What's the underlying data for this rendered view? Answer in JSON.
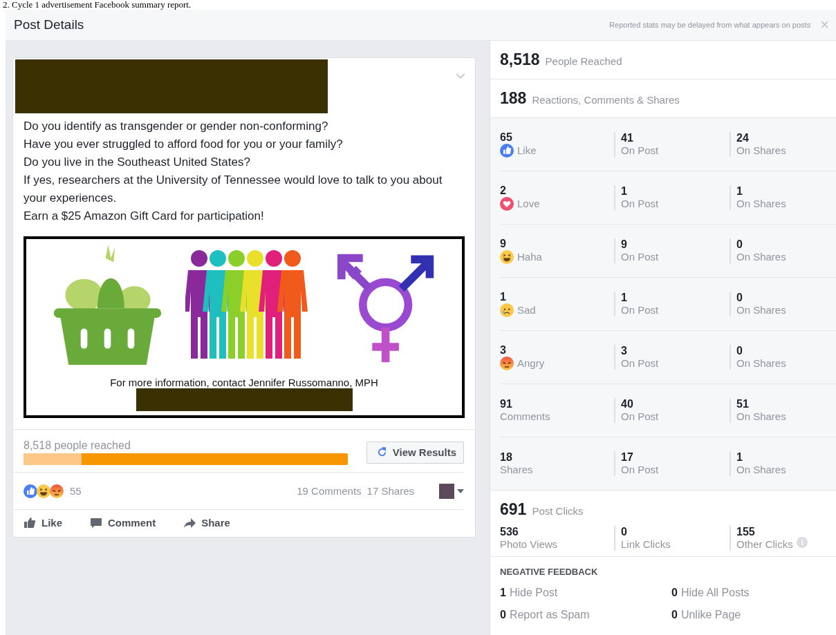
{
  "document_caption": "2. Cycle 1 advertisement Facebook summary report.",
  "header": {
    "title": "Post Details",
    "note": "Reported stats may be delayed from what appears on posts",
    "close": "×"
  },
  "post": {
    "text_lines": [
      "Do you identify as transgender or gender non-conforming?",
      "Have you ever struggled to afford food for you or your family?",
      "Do you live in the Southeast United States?",
      "If yes, researchers at the University of Tennessee would love to talk to you about your experiences.",
      "Earn a $25 Amazon Gift Card for participation!"
    ],
    "image_caption": "For more information, contact Jennifer Russomanno, MPH",
    "reach_label": "8,518 people reached",
    "reach_bar": {
      "level": 0.18
    },
    "view_results": "View Results",
    "reaction_count": "55",
    "comments": "19 Comments",
    "shares": "17 Shares",
    "actions": [
      {
        "label": "Like",
        "kind": "like"
      },
      {
        "label": "Comment",
        "kind": "comment"
      },
      {
        "label": "Share",
        "kind": "share"
      }
    ]
  },
  "stats": {
    "reached": {
      "value": "8,518",
      "label": "People Reached"
    },
    "engagement": {
      "value": "188",
      "label": "Reactions, Comments & Shares"
    },
    "rows": [
      {
        "kind": "like",
        "value": "65",
        "label": "Like",
        "post": "41",
        "post_label": "On Post",
        "shares": "24",
        "shares_label": "On Shares"
      },
      {
        "kind": "love",
        "value": "2",
        "label": "Love",
        "post": "1",
        "post_label": "On Post",
        "shares": "1",
        "shares_label": "On Shares"
      },
      {
        "kind": "haha",
        "value": "9",
        "label": "Haha",
        "post": "9",
        "post_label": "On Post",
        "shares": "0",
        "shares_label": "On Shares"
      },
      {
        "kind": "sad",
        "value": "1",
        "label": "Sad",
        "post": "1",
        "post_label": "On Post",
        "shares": "0",
        "shares_label": "On Shares"
      },
      {
        "kind": "angry",
        "value": "3",
        "label": "Angry",
        "post": "3",
        "post_label": "On Post",
        "shares": "0",
        "shares_label": "On Shares"
      },
      {
        "kind": "plain",
        "value": "91",
        "label": "Comments",
        "post": "40",
        "post_label": "On Post",
        "shares": "51",
        "shares_label": "On Shares"
      },
      {
        "kind": "plain",
        "value": "18",
        "label": "Shares",
        "post": "17",
        "post_label": "On Post",
        "shares": "1",
        "shares_label": "On Shares"
      }
    ],
    "clicks": {
      "value": "691",
      "label": "Post Clicks",
      "items": [
        {
          "value": "536",
          "label": "Photo Views",
          "info": false
        },
        {
          "value": "0",
          "label": "Link Clicks",
          "info": false
        },
        {
          "value": "155",
          "label": "Other Clicks",
          "info": true
        }
      ]
    },
    "negative": {
      "title": "NEGATIVE FEEDBACK",
      "items": [
        {
          "value": "1",
          "label": "Hide Post"
        },
        {
          "value": "0",
          "label": "Hide All Posts"
        },
        {
          "value": "0",
          "label": "Report as Spam"
        },
        {
          "value": "0",
          "label": "Unlike Page"
        }
      ]
    }
  }
}
